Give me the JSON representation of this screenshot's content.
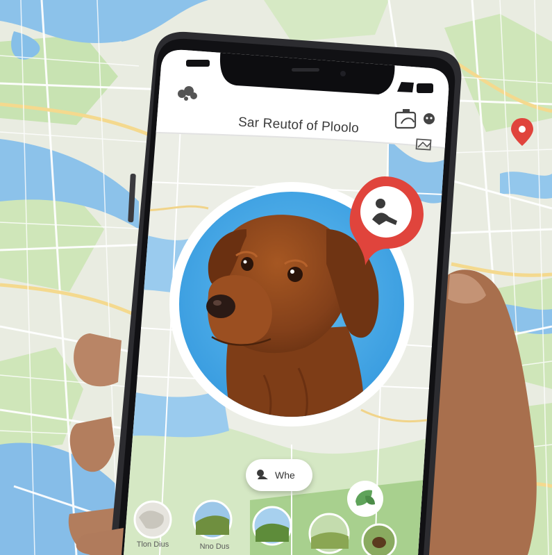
{
  "app": {
    "title": "Sar Reutof of Ploolo",
    "pill_label": "Whe"
  },
  "thumbnails": [
    {
      "label": "Tlon Dius"
    },
    {
      "label": "Nno Dus"
    },
    {
      "label": ""
    },
    {
      "label": ""
    },
    {
      "label": ""
    }
  ],
  "colors": {
    "map_land": "#e9ece1",
    "map_water": "#8cc2ea",
    "map_park": "#c8e3b2",
    "map_road": "#f4d98e",
    "phone_frame": "#2c2c30",
    "pin_red": "#e0443c",
    "circle_blue": "#4faee8",
    "dog_fur": "#8a4418"
  },
  "icons": {
    "status_left": "cloud-icon",
    "header_right": "camera-sync-icon",
    "header_dot": "chat-bubble-icon",
    "map_toggle": "map-icon",
    "pin_badge": "person-pin-icon",
    "pill": "pet-icon",
    "fab": "leaf-icon",
    "map_marker": "location-marker-icon"
  }
}
